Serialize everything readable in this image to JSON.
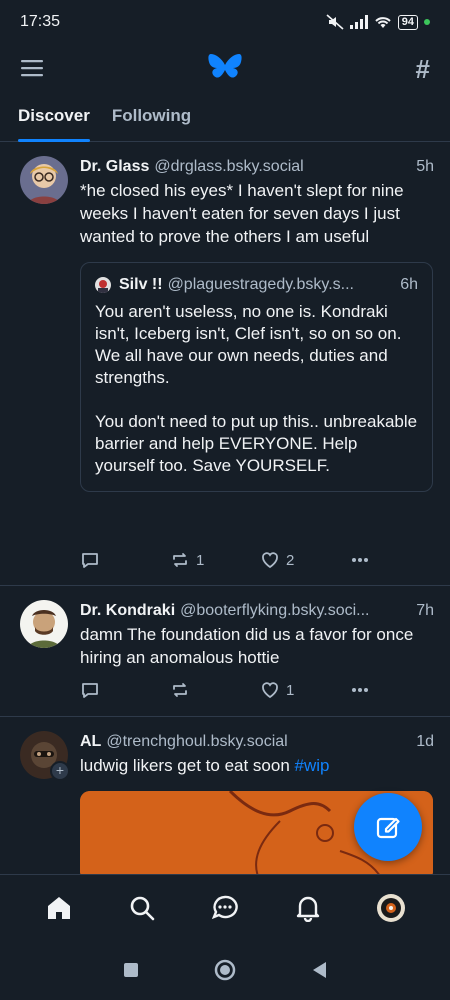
{
  "status": {
    "time": "17:35",
    "battery": "94"
  },
  "tabs": [
    {
      "label": "Discover",
      "active": true
    },
    {
      "label": "Following",
      "active": false
    }
  ],
  "posts": [
    {
      "name": "Dr. Glass",
      "handle": "@drglass.bsky.social",
      "time": "5h",
      "text": "*he closed his eyes* I haven't slept for nine weeks I haven't eaten for seven days I just wanted to prove the others I am useful",
      "quote": {
        "name": "Silv !!",
        "handle": "@plaguestragedy.bsky.s...",
        "time": "6h",
        "text": "You aren't useless, no one is. Kondraki isn't, Iceberg isn't, Clef isn't, so on so on. We all have our own needs, duties and strengths.\n\nYou don't need to put up this.. unbreakable barrier and help EVERYONE. Help yourself too. Save YOURSELF."
      },
      "reposts": "1",
      "likes": "2"
    },
    {
      "name": "Dr. Kondraki",
      "handle": "@booterflyking.bsky.soci...",
      "time": "7h",
      "text": "damn The foundation did us a favor for once hiring an anomalous hottie",
      "reposts": "",
      "likes": "1"
    },
    {
      "name": "AL",
      "handle": "@trenchghoul.bsky.social",
      "time": "1d",
      "text": "ludwig likers get to eat soon ",
      "hashtag": "#wip"
    }
  ],
  "colors": {
    "accent": "#1083fe",
    "background": "#161e27",
    "muted": "#aebbc9",
    "border": "#2e3a4a"
  },
  "icons": {
    "menu": "menu-icon",
    "logo": "butterfly-logo-icon",
    "feeds": "hash-icon",
    "reply": "reply-icon",
    "repost": "repost-icon",
    "like": "heart-icon",
    "more": "more-icon",
    "compose": "compose-icon",
    "home": "home-icon",
    "search": "search-icon",
    "chat": "chat-icon",
    "notifications": "bell-icon",
    "profile": "profile-avatar"
  }
}
